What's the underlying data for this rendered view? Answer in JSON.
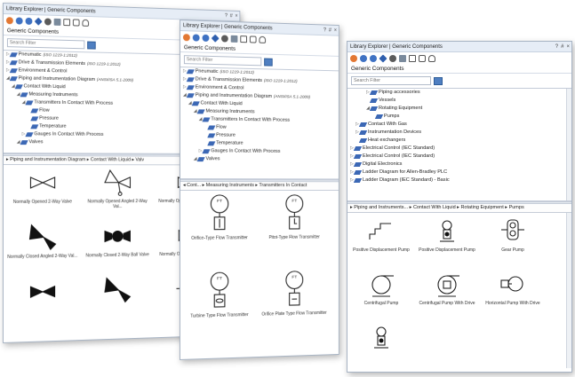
{
  "panels": [
    {
      "title": "Library Explorer | Generic Components",
      "win_buttons": [
        "?",
        "#",
        "×"
      ],
      "header": "Generic Components",
      "search_placeholder": "Search Filter",
      "tree": [
        {
          "label": "Pneumatic",
          "note": "(ISO 1219-1:2012)",
          "level": 0,
          "expander": "▷"
        },
        {
          "label": "Drive & Transmission Elements",
          "note": "(ISO 1219-1:2012)",
          "level": 0,
          "expander": "▷"
        },
        {
          "label": "Environment & Control",
          "note": "",
          "level": 0,
          "expander": "▷"
        },
        {
          "label": "Piping and Instrumentation Diagram",
          "note": "(ANSI/ISA 5.1-2009)",
          "level": 0,
          "expander": "◢"
        },
        {
          "label": "Contact With Liquid",
          "note": "",
          "level": 1,
          "expander": "◢"
        },
        {
          "label": "Measuring Instruments",
          "note": "",
          "level": 2,
          "expander": "◢"
        },
        {
          "label": "Transmitters In Contact With Process",
          "note": "",
          "level": 3,
          "expander": "◢"
        },
        {
          "label": "Flow",
          "note": "",
          "level": 4,
          "expander": ""
        },
        {
          "label": "Pressure",
          "note": "",
          "level": 4,
          "expander": ""
        },
        {
          "label": "Temperature",
          "note": "",
          "level": 4,
          "expander": ""
        },
        {
          "label": "Gauges In Contact With Process",
          "note": "",
          "level": 3,
          "expander": "▷"
        },
        {
          "label": "Valves",
          "note": "",
          "level": 2,
          "expander": "◢"
        }
      ],
      "breadcrumb": "▸ Piping and Instrumentation Diagram ▸ Contact With Liquid ▸ Valv",
      "symbols": [
        {
          "label": "Normally Opened 2-Way Valve",
          "shape": "valve-open"
        },
        {
          "label": "Normally Opened Angled 2-Way Val...",
          "shape": "valve-angled-open"
        },
        {
          "label": "Normally Opened 2-Way Ball Valve",
          "shape": "ball-open"
        },
        {
          "label": "Normally Closed Angled 2-Way Val...",
          "shape": "valve-angled-closed"
        },
        {
          "label": "Normally Closed 2-Way Ball Valve",
          "shape": "ball-closed"
        },
        {
          "label": "Normally Opened 2-Way Solenoid V...",
          "shape": "valve-open"
        },
        {
          "label": "",
          "shape": "valve-closed"
        },
        {
          "label": "",
          "shape": "valve-angled-closed"
        },
        {
          "label": "",
          "shape": "plates"
        }
      ]
    },
    {
      "title": "Library Explorer | Generic Components",
      "win_buttons": [
        "?",
        "#",
        "×"
      ],
      "header": "Generic Components",
      "search_placeholder": "Search Filter",
      "tree": [
        {
          "label": "Pneumatic",
          "note": "(ISO 1219-1:2012)",
          "level": 0,
          "expander": "▷"
        },
        {
          "label": "Drive & Transmission Elements",
          "note": "(ISO 1219-1:2012)",
          "level": 0,
          "expander": "▷"
        },
        {
          "label": "Environment & Control",
          "note": "",
          "level": 0,
          "expander": "▷"
        },
        {
          "label": "Piping and Instrumentation Diagram",
          "note": "(ANSI/ISA 5.1-2009)",
          "level": 0,
          "expander": "◢"
        },
        {
          "label": "Contact With Liquid",
          "note": "",
          "level": 1,
          "expander": "◢"
        },
        {
          "label": "Measuring Instruments",
          "note": "",
          "level": 2,
          "expander": "◢"
        },
        {
          "label": "Transmitters In Contact With Process",
          "note": "",
          "level": 3,
          "expander": "◢"
        },
        {
          "label": "Flow",
          "note": "",
          "level": 4,
          "expander": ""
        },
        {
          "label": "Pressure",
          "note": "",
          "level": 4,
          "expander": ""
        },
        {
          "label": "Temperature",
          "note": "",
          "level": 4,
          "expander": ""
        },
        {
          "label": "Gauges In Contact With Process",
          "note": "",
          "level": 3,
          "expander": "▷"
        },
        {
          "label": "Valves",
          "note": "",
          "level": 2,
          "expander": "◢"
        }
      ],
      "breadcrumb": "◂ Cont... ▸ Measuring Instruments ▸ Transmitters In Contact",
      "symbols": [
        {
          "label": "Orifice-Type Flow Transmitter",
          "shape": "ft-orifice",
          "text": "FT"
        },
        {
          "label": "Pitot-Type Flow Transmitter",
          "shape": "ft-pitot",
          "text": "FT"
        },
        {
          "label": "Turbine Type Flow Transmitter",
          "shape": "ft-turbine",
          "text": "FT"
        },
        {
          "label": "Orifice Plate Type Flow Transmitter",
          "shape": "ft-plate",
          "text": "FT"
        }
      ]
    },
    {
      "title": "Library Explorer | Generic Components",
      "win_buttons": [
        "?",
        "#",
        "×"
      ],
      "header": "Generic Components",
      "search_placeholder": "Search Filter",
      "tree": [
        {
          "label": "Piping accessories",
          "note": "",
          "level": 3,
          "expander": "▷"
        },
        {
          "label": "Vessels",
          "note": "",
          "level": 3,
          "expander": ""
        },
        {
          "label": "Rotating Equipment",
          "note": "",
          "level": 3,
          "expander": "◢"
        },
        {
          "label": "Pumps",
          "note": "",
          "level": 4,
          "expander": ""
        },
        {
          "label": "Contact With Gas",
          "note": "",
          "level": 1,
          "expander": "▷"
        },
        {
          "label": "Instrumentation Devices",
          "note": "",
          "level": 1,
          "expander": "▷"
        },
        {
          "label": "Heat exchangers",
          "note": "",
          "level": 1,
          "expander": ""
        },
        {
          "label": "Electrical Control (IEC Standard)",
          "note": "",
          "level": 0,
          "expander": "▷"
        },
        {
          "label": "Electrical Control (IEC Standard)",
          "note": "",
          "level": 0,
          "expander": "▷"
        },
        {
          "label": "Digital Electronics",
          "note": "",
          "level": 0,
          "expander": "▷"
        },
        {
          "label": "Ladder Diagram for Allen-Bradley PLC",
          "note": "",
          "level": 0,
          "expander": "▷"
        },
        {
          "label": "Ladder Diagram (IEC Standard) - Basic",
          "note": "",
          "level": 0,
          "expander": "▷"
        }
      ],
      "breadcrumb": "▸ Piping and Instruments... ▸ Contact With Liquid ▸ Rotating Equipment ▸ Pumps",
      "symbols": [
        {
          "label": "Positive Displacement Pump",
          "shape": "pd-pump"
        },
        {
          "label": "Positive Displacement Pump",
          "shape": "pd-pump2"
        },
        {
          "label": "Gear Pump",
          "shape": "gear-pump"
        },
        {
          "label": "Centrifugal Pump",
          "shape": "centrifugal"
        },
        {
          "label": "Centrifugal Pump With Drive",
          "shape": "centrifugal-drive"
        },
        {
          "label": "Horizontal Pump With Drive",
          "shape": "horizontal-pump"
        },
        {
          "label": "",
          "shape": "vertical-pump"
        }
      ]
    }
  ]
}
